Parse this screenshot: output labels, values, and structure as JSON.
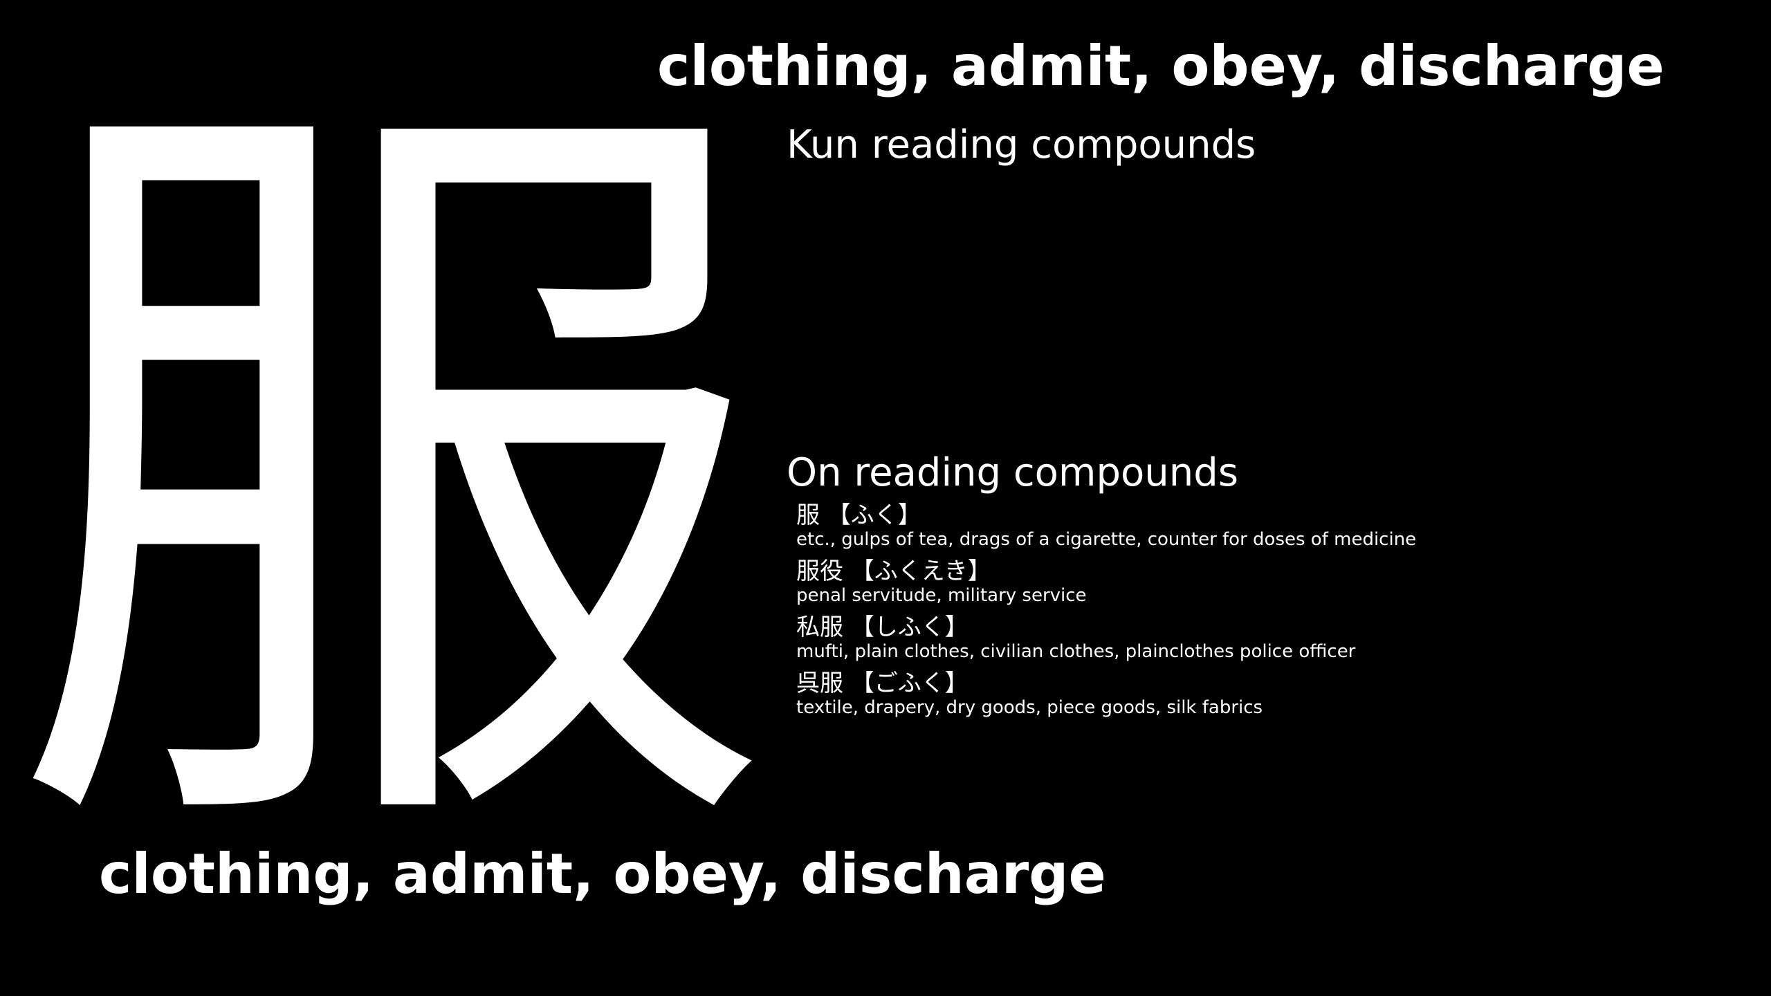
{
  "kanji": "服",
  "meanings": "clothing, admit, obey, discharge",
  "kun_heading": "Kun reading compounds",
  "on_heading": "On reading compounds",
  "on_compounds": [
    {
      "word": "服 【ふく】",
      "meaning": "etc., gulps of tea, drags of a cigarette, counter for doses of medicine"
    },
    {
      "word": "服役 【ふくえき】",
      "meaning": "penal servitude, military service"
    },
    {
      "word": "私服 【しふく】",
      "meaning": "mufti, plain clothes, civilian clothes, plainclothes police officer"
    },
    {
      "word": "呉服 【ごふく】",
      "meaning": "textile, drapery, dry goods, piece goods, silk fabrics"
    }
  ],
  "colors": {
    "background": "#000000",
    "text": "#ffffff"
  }
}
